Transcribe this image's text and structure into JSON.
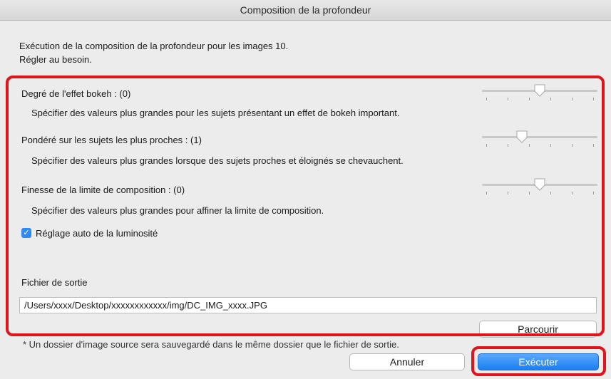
{
  "window": {
    "title": "Composition de la profondeur"
  },
  "intro": {
    "line1": "Exécution de la composition de la profondeur pour les images 10.",
    "line2": "Régler au besoin."
  },
  "settings": [
    {
      "label": "Degré de l'effet bokeh : (0)",
      "hint": "Spécifier des valeurs plus grandes pour les sujets présentant un effet de bokeh important.",
      "ticks": 6,
      "position": 0.5
    },
    {
      "label": "Pondéré sur les sujets les plus proches : (1)",
      "hint": "Spécifier des valeurs plus grandes lorsque des sujets proches et éloignés se chevauchent.",
      "ticks": 6,
      "position": 0.333
    },
    {
      "label": "Finesse de la limite de composition : (0)",
      "hint": "Spécifier des valeurs plus grandes pour affiner la limite de composition.",
      "ticks": 6,
      "position": 0.5
    }
  ],
  "auto_brightness": {
    "label": "Réglage auto de la luminosité",
    "checked": true
  },
  "output": {
    "label": "Fichier de sortie",
    "path": "/Users/xxxx/Desktop/xxxxxxxxxxxx/img/DC_IMG_xxxx.JPG",
    "browse_label": "Parcourir",
    "note": "* Un dossier d'image source sera sauvegardé dans le même dossier que le fichier de sortie."
  },
  "buttons": {
    "cancel_label": "Annuler",
    "execute_label": "Exécuter"
  },
  "colors": {
    "highlight": "#e0141c",
    "accent": "#1a7ef3"
  }
}
